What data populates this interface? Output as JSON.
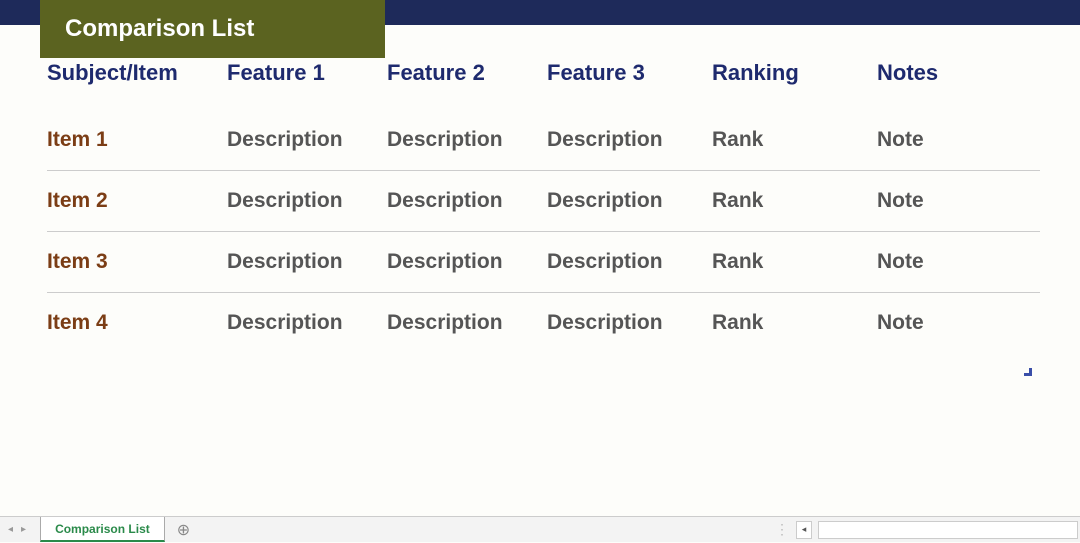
{
  "title": "Comparison List",
  "headers": [
    "Subject/Item",
    "Feature 1",
    "Feature 2",
    "Feature 3",
    "Ranking",
    "Notes"
  ],
  "rows": [
    {
      "item": "Item 1",
      "f1": "Description",
      "f2": "Description",
      "f3": "Description",
      "rank": "Rank",
      "note": "Note"
    },
    {
      "item": "Item 2",
      "f1": "Description",
      "f2": "Description",
      "f3": "Description",
      "rank": "Rank",
      "note": "Note"
    },
    {
      "item": "Item 3",
      "f1": "Description",
      "f2": "Description",
      "f3": "Description",
      "rank": "Rank",
      "note": "Note"
    },
    {
      "item": "Item 4",
      "f1": "Description",
      "f2": "Description",
      "f3": "Description",
      "rank": "Rank",
      "note": "Note"
    }
  ],
  "sheet_tab": "Comparison List",
  "add_sheet_glyph": "⊕",
  "nav_prev": "◂",
  "nav_next": "▸",
  "scroll_left": "◂",
  "scroll_sep": "⋮"
}
